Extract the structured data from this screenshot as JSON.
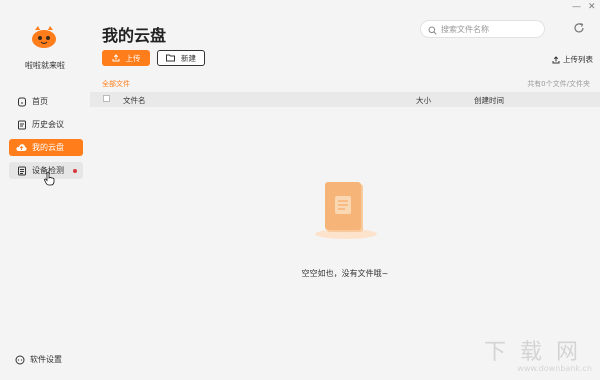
{
  "sidebar": {
    "brand": "啦啦就来啦",
    "items": [
      {
        "label": "首页",
        "icon": "home-icon"
      },
      {
        "label": "历史会议",
        "icon": "history-icon"
      },
      {
        "label": "我的云盘",
        "icon": "cloud-icon"
      },
      {
        "label": "设备检测",
        "icon": "device-icon"
      }
    ],
    "settings_label": "软件设置"
  },
  "window": {
    "minimize": "—",
    "close": "✕"
  },
  "main": {
    "title": "我的云盘",
    "search_placeholder": "搜索文件名称",
    "upload_label": "上传",
    "new_label": "新建",
    "upload_list_label": "上传列表",
    "breadcrumb": "全部文件",
    "file_count": "共有0个文件/文件夹",
    "columns": {
      "name": "文件名",
      "size": "大小",
      "created": "创建时间"
    },
    "empty_text": "空空如也，没有文件哦~"
  },
  "watermark": {
    "cn": "下载网",
    "en": "www.downbank.cn"
  },
  "colors": {
    "accent": "#ff7d1a",
    "badge": "#d9363e"
  }
}
